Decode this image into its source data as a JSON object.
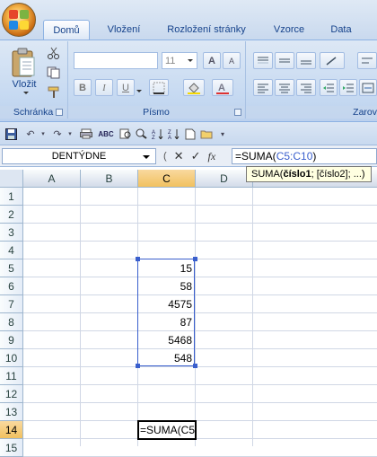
{
  "ribbon": {
    "tabs": [
      "Domů",
      "Vložení",
      "Rozložení stránky",
      "Vzorce",
      "Data"
    ],
    "active_tab": "Domů",
    "groups": {
      "clipboard": {
        "label": "Schránka",
        "paste_label": "Vložit"
      },
      "font": {
        "label": "Písmo",
        "font_size": "11",
        "bold": "B",
        "italic": "I",
        "underline": "U",
        "grow": "A",
        "shrink": "A"
      },
      "alignment": {
        "label": "Zarov"
      }
    }
  },
  "formula_bar": {
    "name_box": "DENTÝDNE",
    "cancel_symbol": "✕",
    "enter_symbol": "✓",
    "fx_label": "fx",
    "formula_prefix": "=SUMA(",
    "formula_ref": "C5:C10",
    "formula_suffix": ")"
  },
  "tooltip": {
    "fn": "SUMA(",
    "arg1": "číslo1",
    "rest": "; [číslo2]; ...)"
  },
  "grid": {
    "columns": [
      "A",
      "B",
      "C",
      "D"
    ],
    "selected_column": "C",
    "rows": [
      "1",
      "2",
      "3",
      "4",
      "5",
      "6",
      "7",
      "8",
      "9",
      "10",
      "11",
      "12",
      "13",
      "14",
      "15"
    ],
    "selected_row": "14",
    "c_values": {
      "r5": "15",
      "r6": "58",
      "r7": "4575",
      "r8": "87",
      "r9": "5468",
      "r10": "548"
    },
    "editing_cell_text": "=SUMA(C5"
  },
  "colors": {
    "ribbon_blue": "#c4d8f1",
    "selection_border": "#3a5fcd",
    "tooltip_bg": "#ffffe1",
    "header_selected": "#f1c15f"
  }
}
